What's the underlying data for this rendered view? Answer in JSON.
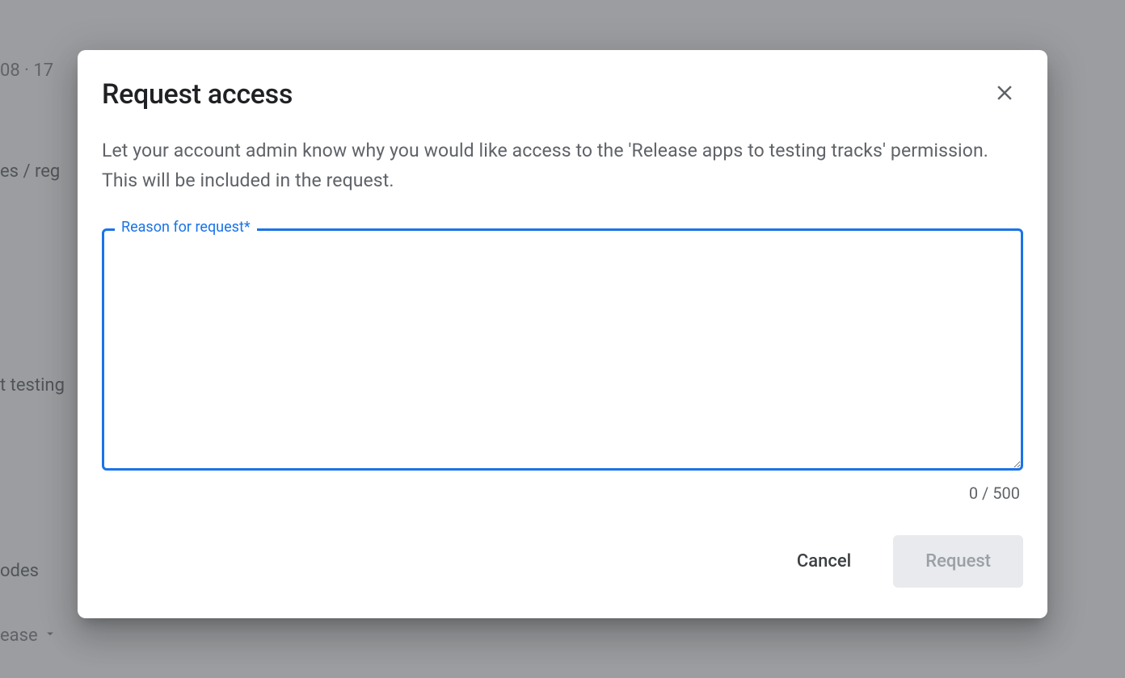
{
  "background": {
    "top_text": "08 · 17",
    "item_1": "es / reg",
    "item_2": "t testing",
    "item_3": "odes",
    "item_4": "ease"
  },
  "dialog": {
    "title": "Request access",
    "description": "Let your account admin know why you would like access to the 'Release apps to testing tracks' permission. This will be included in the request.",
    "textarea_label": "Reason for request*",
    "textarea_value": "",
    "char_count": "0 / 500",
    "cancel_label": "Cancel",
    "request_label": "Request"
  }
}
